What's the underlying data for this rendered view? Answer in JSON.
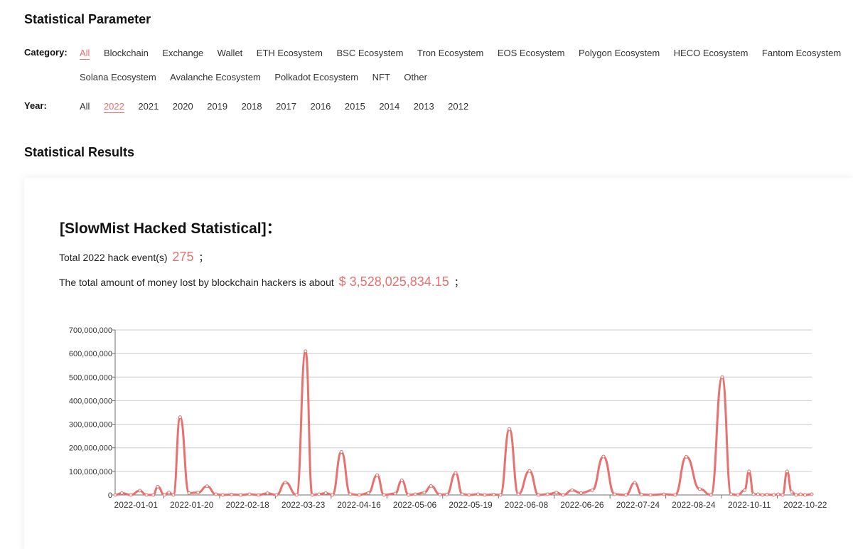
{
  "param_title": "Statistical Parameter",
  "category": {
    "label": "Category:",
    "options": [
      "All",
      "Blockchain",
      "Exchange",
      "Wallet",
      "ETH Ecosystem",
      "BSC Ecosystem",
      "Tron Ecosystem",
      "EOS Ecosystem",
      "Polygon Ecosystem",
      "HECO Ecosystem",
      "Fantom Ecosystem",
      "Solana Ecosystem",
      "Avalanche Ecosystem",
      "Polkadot Ecosystem",
      "NFT",
      "Other"
    ],
    "selected": "All"
  },
  "year": {
    "label": "Year:",
    "options": [
      "All",
      "2022",
      "2021",
      "2020",
      "2019",
      "2018",
      "2017",
      "2016",
      "2015",
      "2014",
      "2013",
      "2012"
    ],
    "selected": "2022"
  },
  "results_title": "Statistical Results",
  "card": {
    "title": "[SlowMist Hacked Statistical]：",
    "events_prefix": "Total 2022 hack event(s)",
    "events_count": "275",
    "events_suffix": "；",
    "amount_prefix": "The total amount of money lost by blockchain hackers is about",
    "amount_value": "$ 3,528,025,834.15",
    "amount_suffix": "；"
  },
  "colors": {
    "accent": "#e8706e",
    "line": "#e8706e"
  },
  "chart_data": {
    "type": "line",
    "x_tick_labels": [
      "2022-01-01",
      "2022-01-20",
      "2022-02-18",
      "2022-03-23",
      "2022-04-16",
      "2022-05-06",
      "2022-05-19",
      "2022-06-08",
      "2022-06-26",
      "2022-07-24",
      "2022-08-24",
      "2022-10-11",
      "2022-10-22"
    ],
    "y_ticks": [
      "0",
      "100,000,000",
      "200,000,000",
      "300,000,000",
      "400,000,000",
      "500,000,000",
      "600,000,000",
      "700,000,000"
    ],
    "ylim": [
      0,
      700000000
    ],
    "grid": true,
    "series": [
      {
        "x": [
          "2022-01-01",
          "2022-01-04",
          "2022-01-08",
          "2022-01-12",
          "2022-01-15",
          "2022-01-18",
          "2022-01-20",
          "2022-01-23",
          "2022-01-25",
          "2022-01-27",
          "2022-01-30",
          "2022-02-03",
          "2022-02-07",
          "2022-02-11",
          "2022-02-15",
          "2022-02-18",
          "2022-02-22",
          "2022-02-26",
          "2022-03-02",
          "2022-03-06",
          "2022-03-10",
          "2022-03-14",
          "2022-03-18",
          "2022-03-23",
          "2022-03-27",
          "2022-03-30",
          "2022-04-02",
          "2022-04-05",
          "2022-04-08",
          "2022-04-12",
          "2022-04-16",
          "2022-04-20",
          "2022-04-24",
          "2022-04-28",
          "2022-05-01",
          "2022-05-06",
          "2022-05-09",
          "2022-05-12",
          "2022-05-15",
          "2022-05-19",
          "2022-05-22",
          "2022-05-26",
          "2022-05-29",
          "2022-06-02",
          "2022-06-05",
          "2022-06-08",
          "2022-06-12",
          "2022-06-15",
          "2022-06-19",
          "2022-06-22",
          "2022-06-26",
          "2022-06-30",
          "2022-07-05",
          "2022-07-09",
          "2022-07-13",
          "2022-07-17",
          "2022-07-20",
          "2022-07-24",
          "2022-07-28",
          "2022-08-02",
          "2022-08-07",
          "2022-08-12",
          "2022-08-17",
          "2022-08-21",
          "2022-08-24",
          "2022-08-28",
          "2022-09-03",
          "2022-09-08",
          "2022-09-13",
          "2022-09-19",
          "2022-09-24",
          "2022-09-29",
          "2022-10-03",
          "2022-10-06",
          "2022-10-09",
          "2022-10-11",
          "2022-10-13",
          "2022-10-15",
          "2022-10-17",
          "2022-10-19",
          "2022-10-22",
          "2022-10-24",
          "2022-10-26",
          "2022-10-28",
          "2022-10-30",
          "2022-11-01",
          "2022-11-03",
          "2022-11-05",
          "2022-11-08"
        ],
        "values": [
          0,
          8000000,
          0,
          18000000,
          0,
          0,
          35000000,
          0,
          10000000,
          0,
          330000000,
          8000000,
          10000000,
          37000000,
          3000000,
          0,
          2000000,
          0,
          3000000,
          0,
          7000000,
          0,
          53000000,
          0,
          610000000,
          0,
          3000000,
          8000000,
          0,
          183000000,
          3000000,
          0,
          8000000,
          84000000,
          0,
          6000000,
          62000000,
          0,
          3000000,
          10000000,
          38000000,
          2000000,
          2000000,
          93000000,
          3000000,
          0,
          3000000,
          0,
          2000000,
          0,
          280000000,
          3000000,
          102000000,
          0,
          3000000,
          10000000,
          0,
          20000000,
          8000000,
          20000000,
          163000000,
          3000000,
          0,
          52000000,
          2000000,
          0,
          3000000,
          0,
          162000000,
          25000000,
          0,
          500000000,
          3000000,
          0,
          20000000,
          100000000,
          3000000,
          3000000,
          0,
          2000000,
          0,
          3000000,
          0,
          100000000,
          13000000,
          0,
          3000000,
          0,
          3000000
        ]
      }
    ]
  }
}
